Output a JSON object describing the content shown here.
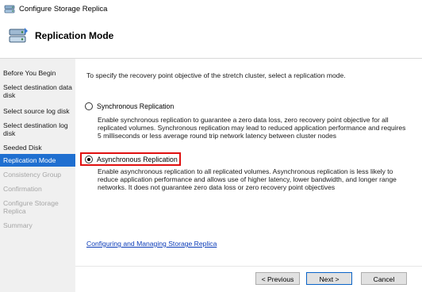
{
  "window": {
    "title": "Configure Storage Replica"
  },
  "header": {
    "title": "Replication Mode"
  },
  "nav": {
    "items": [
      {
        "label": "Before You Begin",
        "state": "normal"
      },
      {
        "label": "Select destination data disk",
        "state": "normal"
      },
      {
        "label": "Select source log disk",
        "state": "normal"
      },
      {
        "label": "Select destination log disk",
        "state": "normal"
      },
      {
        "label": "Seeded Disk",
        "state": "normal"
      },
      {
        "label": "Replication Mode",
        "state": "active"
      },
      {
        "label": "Consistency Group",
        "state": "disabled"
      },
      {
        "label": "Confirmation",
        "state": "disabled"
      },
      {
        "label": "Configure Storage Replica",
        "state": "disabled"
      },
      {
        "label": "Summary",
        "state": "disabled"
      }
    ]
  },
  "main": {
    "intro": "To specify the recovery point objective of the stretch cluster, select a replication mode.",
    "options": [
      {
        "label": "Synchronous Replication",
        "checked": false,
        "description": "Enable synchronous replication to guarantee a zero data loss, zero recovery point objective for all replicated volumes. Synchronous replication may lead to reduced application performance and requires 5 milliseconds or less average round trip network latency between cluster nodes"
      },
      {
        "label": "Asynchronous Replication",
        "checked": true,
        "description": "Enable asynchronous replication to all replicated volumes. Asynchronous replication is less likely to reduce application performance and allows use of higher latency, lower bandwidth, and longer range networks. It does not guarantee zero data loss or zero recovery point objectives"
      }
    ],
    "link": "Configuring and Managing Storage Replica"
  },
  "footer": {
    "previous_label": "< Previous",
    "next_label": "Next >",
    "cancel_label": "Cancel"
  },
  "colors": {
    "active_nav": "#1f6fd0",
    "highlight_border": "#e01010",
    "link": "#0a3bb8"
  },
  "icons": {
    "app": "storage-replica-icon",
    "header": "storage-replica-header-icon"
  }
}
